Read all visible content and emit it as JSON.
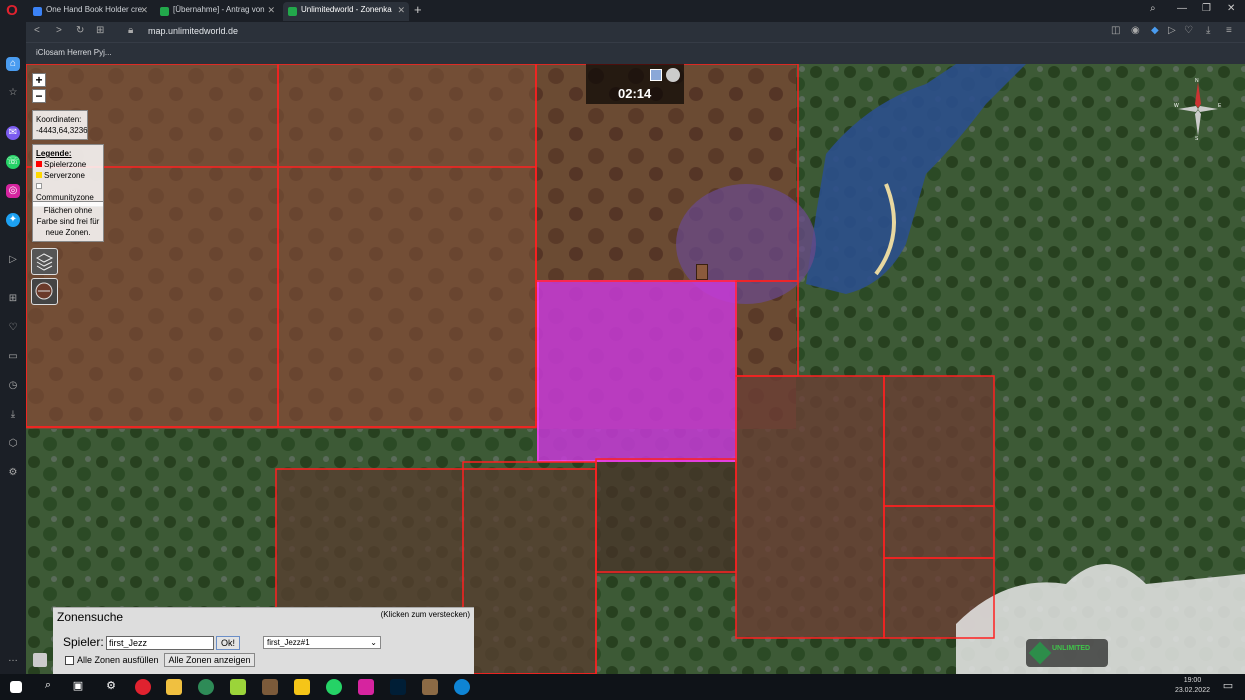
{
  "browser": {
    "tabs": [
      {
        "label": "One Hand Book Holder cre",
        "color": "#3b82f6"
      },
      {
        "label": "[Übernahme] - Antrag von",
        "color": "#22a84b"
      },
      {
        "label": "Unlimitedworld - Zonenka",
        "color": "#22a84b"
      }
    ],
    "url": "map.unlimitedworld.de",
    "bookmark": "iClosam Herren Pyj..."
  },
  "map": {
    "zoom_in": "+",
    "zoom_out": "−",
    "coords_label": "Koordinaten:",
    "coords_value": "-4443,64,3236",
    "legend_title": "Legende:",
    "legend": [
      {
        "label": "Spielerzone",
        "color": "#ff0000"
      },
      {
        "label": "Serverzone",
        "color": "#ffd800"
      },
      {
        "label": "Communityzone",
        "color": "#ffffff"
      }
    ],
    "note": "Flächen ohne Farbe sind frei für neue Zonen.",
    "time": "02:14",
    "compass": {
      "n": "N",
      "s": "S",
      "e": "E",
      "w": "W"
    }
  },
  "zonensuche": {
    "title": "Zonensuche",
    "hide_hint": "(Klicken zum verstecken)",
    "player_label": "Spieler:",
    "player_value": "first_Jezz",
    "ok_label": "Ok!",
    "select_value": "first_Jezz#1",
    "fill_label": "Alle Zonen ausfüllen",
    "show_all_label": "Alle Zonen anzeigen"
  },
  "logo": "UNLIMITED",
  "clock": {
    "time": "19:00",
    "date": "23.02.2022"
  }
}
